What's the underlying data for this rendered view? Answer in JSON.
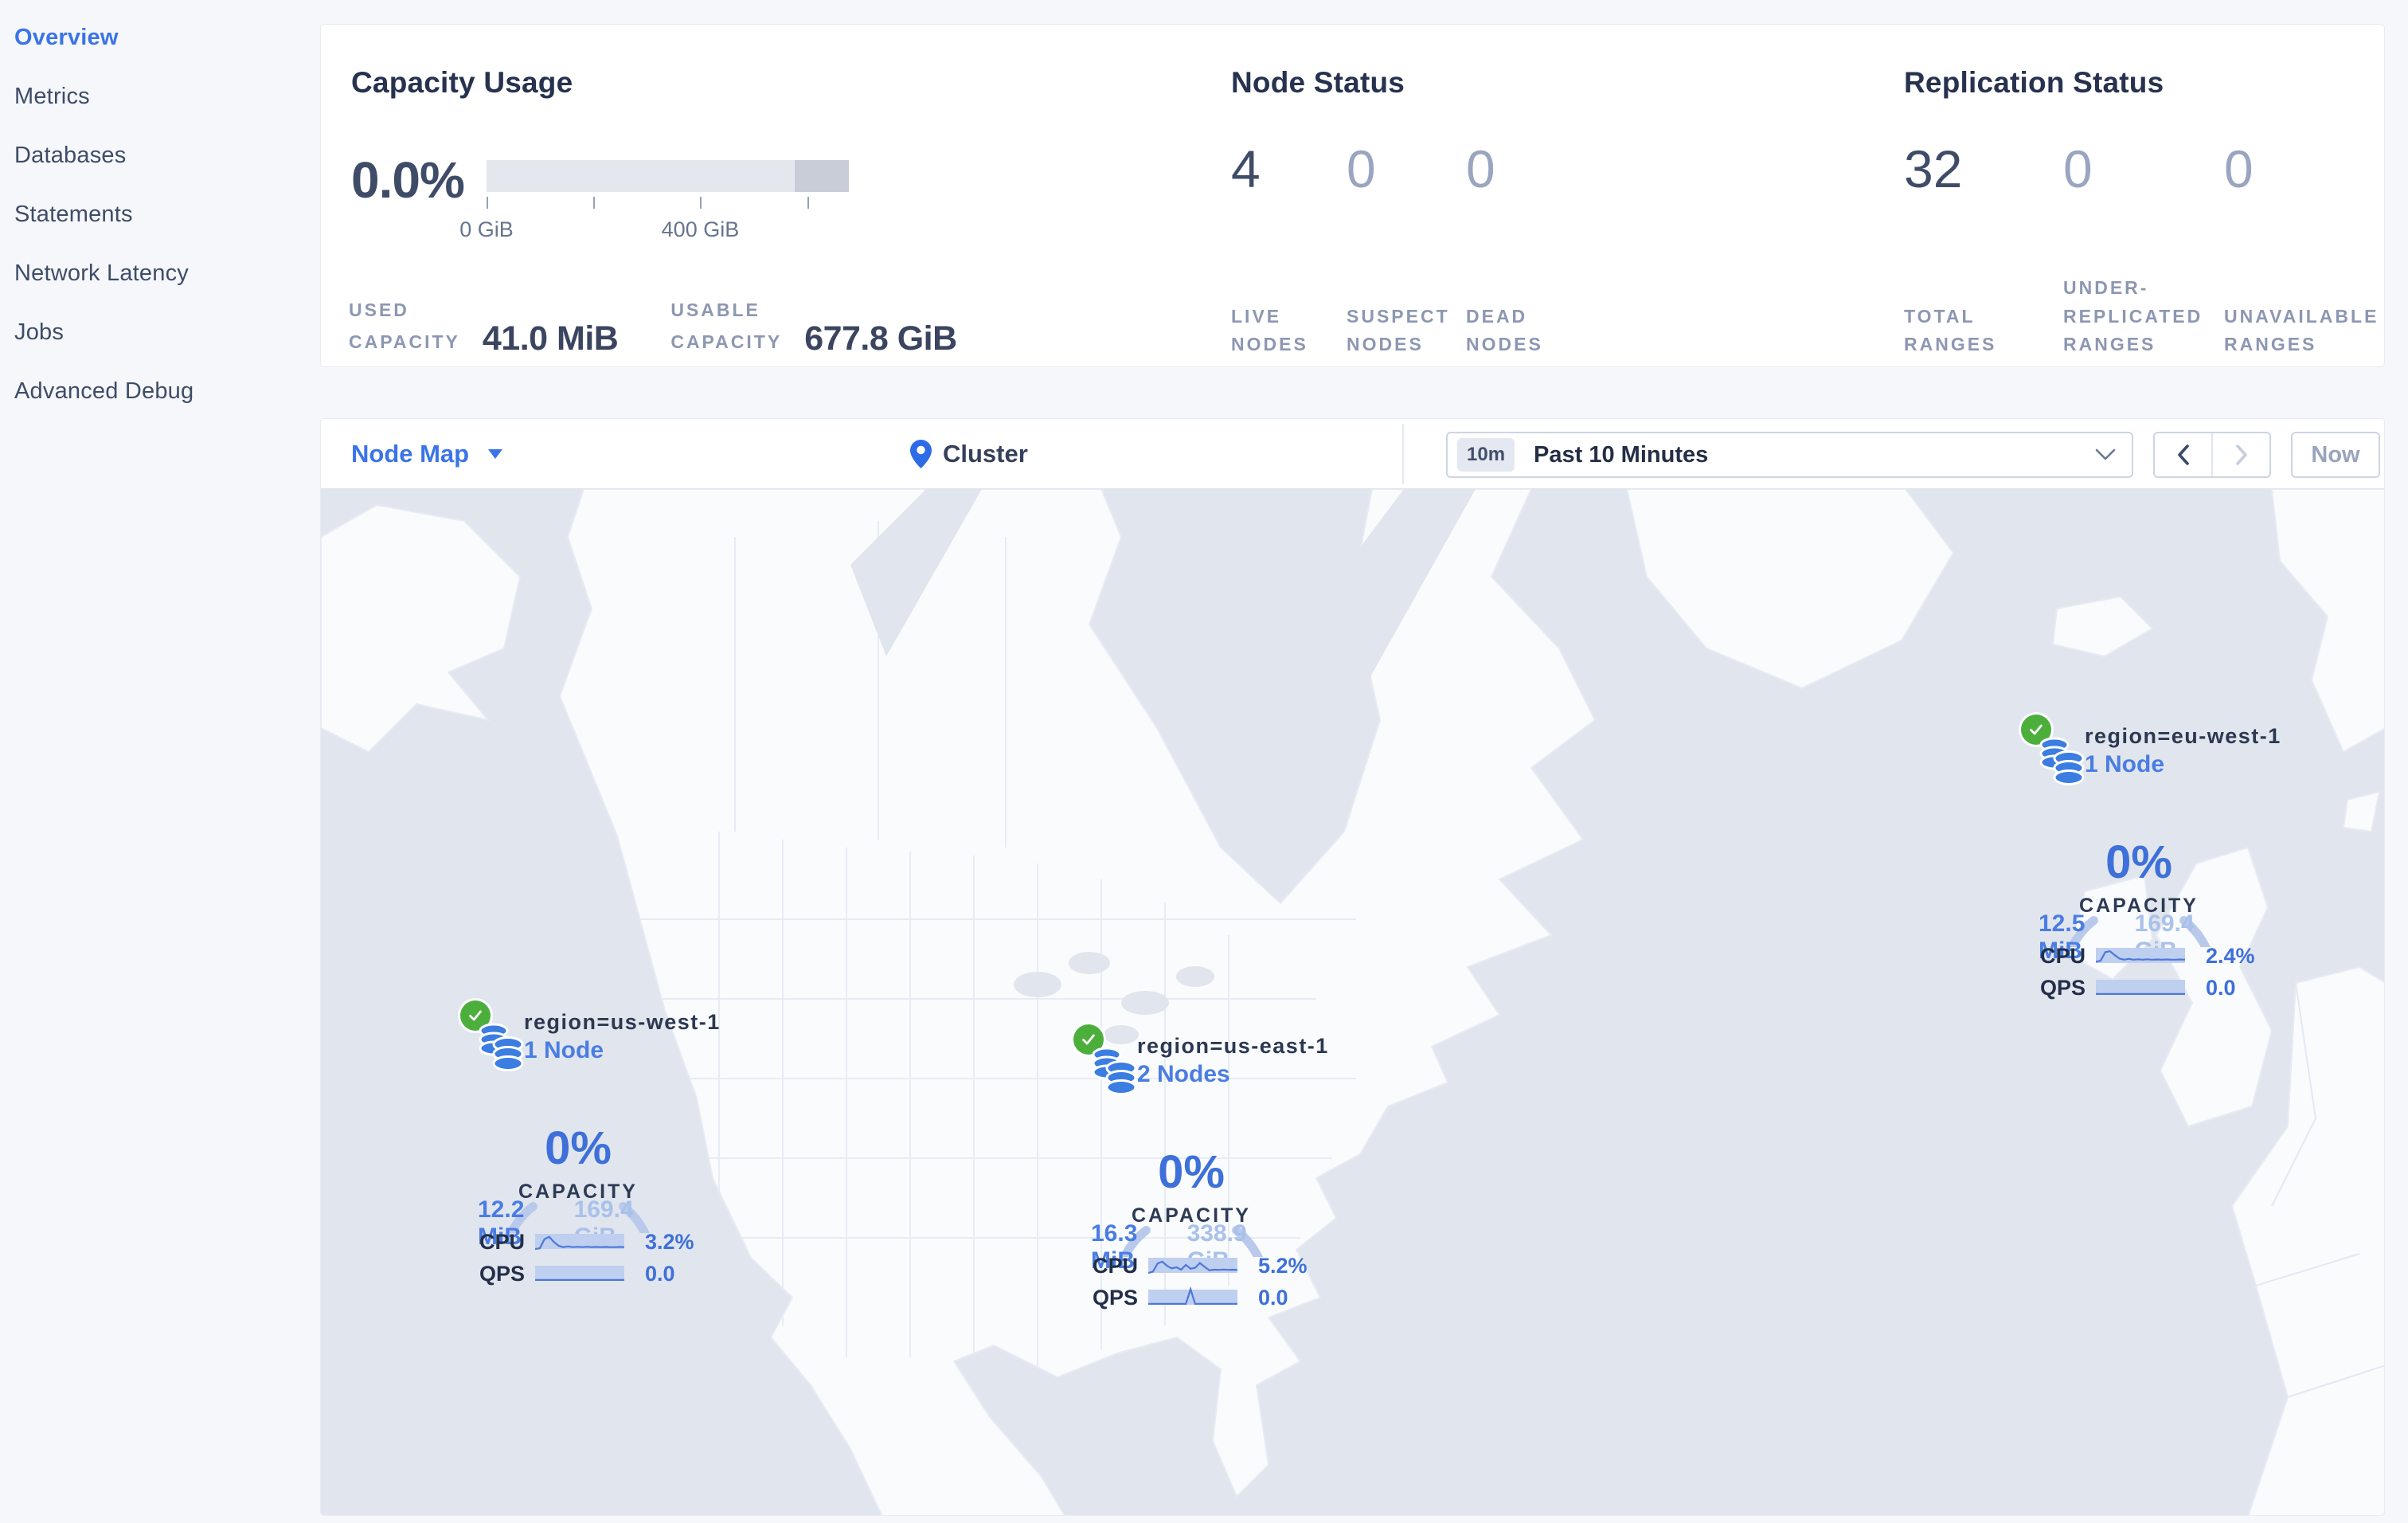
{
  "sidebar": {
    "items": [
      {
        "label": "Overview",
        "active": true
      },
      {
        "label": "Metrics",
        "active": false
      },
      {
        "label": "Databases",
        "active": false
      },
      {
        "label": "Statements",
        "active": false
      },
      {
        "label": "Network Latency",
        "active": false
      },
      {
        "label": "Jobs",
        "active": false
      },
      {
        "label": "Advanced Debug",
        "active": false
      }
    ]
  },
  "capacity_usage": {
    "title": "Capacity Usage",
    "percent": "0.0%",
    "bar": {
      "reserved_fraction": 0.15,
      "ticks": [
        {
          "pos": 0.0,
          "label": "0 GiB"
        },
        {
          "pos": 0.295,
          "label": ""
        },
        {
          "pos": 0.59,
          "label": "400 GiB"
        },
        {
          "pos": 0.885,
          "label": ""
        }
      ]
    },
    "stats": [
      {
        "label_lines": [
          "USED",
          "CAPACITY"
        ],
        "value": "41.0 MiB"
      },
      {
        "label_lines": [
          "USABLE",
          "CAPACITY"
        ],
        "value": "677.8 GiB"
      }
    ]
  },
  "node_status": {
    "title": "Node Status",
    "metrics": [
      {
        "value": "4",
        "label_lines": [
          "LIVE",
          "NODES"
        ],
        "emphasized": true
      },
      {
        "value": "0",
        "label_lines": [
          "SUSPECT",
          "NODES"
        ],
        "emphasized": false
      },
      {
        "value": "0",
        "label_lines": [
          "DEAD",
          "NODES"
        ],
        "emphasized": false
      }
    ]
  },
  "replication_status": {
    "title": "Replication Status",
    "metrics": [
      {
        "value": "32",
        "label_lines": [
          "TOTAL",
          "RANGES"
        ],
        "emphasized": true
      },
      {
        "value": "0",
        "label_lines": [
          "UNDER-",
          "REPLICATED",
          "RANGES"
        ],
        "emphasized": false
      },
      {
        "value": "0",
        "label_lines": [
          "UNAVAILABLE",
          "RANGES"
        ],
        "emphasized": false
      }
    ]
  },
  "toolbar": {
    "view_selector": "Node Map",
    "breadcrumb": "Cluster",
    "time_badge": "10m",
    "time_range": "Past 10 Minutes",
    "now_label": "Now"
  },
  "map": {
    "regions": [
      {
        "name": "region=us-west-1",
        "nodes": "1 Node",
        "capacity_percent": "0%",
        "capacity_label": "CAPACITY",
        "used": "12.2 MiB",
        "usable": "169.4 GiB",
        "cpu_label": "CPU",
        "cpu_value": "3.2%",
        "qps_label": "QPS",
        "qps_value": "0.0",
        "cpu_spark": [
          0.92,
          0.88,
          0.4,
          0.28,
          0.55,
          0.75,
          0.82,
          0.78,
          0.82,
          0.8,
          0.82,
          0.8,
          0.82,
          0.81,
          0.82,
          0.81,
          0.82,
          0.82,
          0.81,
          0.82
        ],
        "qps_spark": [
          0.87,
          0.87,
          0.87,
          0.87,
          0.87,
          0.87,
          0.87,
          0.87,
          0.87,
          0.87,
          0.87,
          0.87,
          0.87,
          0.87,
          0.87,
          0.87,
          0.87,
          0.87,
          0.87,
          0.87
        ]
      },
      {
        "name": "region=us-east-1",
        "nodes": "2 Nodes",
        "capacity_percent": "0%",
        "capacity_label": "CAPACITY",
        "used": "16.3 MiB",
        "usable": "338.9 GiB",
        "cpu_label": "CPU",
        "cpu_value": "5.2%",
        "qps_label": "QPS",
        "qps_value": "0.0",
        "cpu_spark": [
          0.92,
          0.85,
          0.42,
          0.33,
          0.55,
          0.68,
          0.62,
          0.75,
          0.5,
          0.7,
          0.65,
          0.4,
          0.6,
          0.78,
          0.75,
          0.76,
          0.74,
          0.76,
          0.75,
          0.76
        ],
        "qps_spark": [
          0.87,
          0.87,
          0.87,
          0.87,
          0.87,
          0.87,
          0.87,
          0.87,
          0.87,
          0.1,
          0.87,
          0.87,
          0.87,
          0.87,
          0.87,
          0.87,
          0.87,
          0.87,
          0.87,
          0.87
        ]
      },
      {
        "name": "region=eu-west-1",
        "nodes": "1 Node",
        "capacity_percent": "0%",
        "capacity_label": "CAPACITY",
        "used": "12.5 MiB",
        "usable": "169.4 GiB",
        "cpu_label": "CPU",
        "cpu_value": "2.4%",
        "qps_label": "QPS",
        "qps_value": "0.0",
        "cpu_spark": [
          0.85,
          0.8,
          0.35,
          0.3,
          0.5,
          0.68,
          0.74,
          0.7,
          0.74,
          0.72,
          0.74,
          0.72,
          0.74,
          0.73,
          0.74,
          0.73,
          0.74,
          0.74,
          0.73,
          0.74
        ],
        "qps_spark": [
          0.87,
          0.87,
          0.87,
          0.87,
          0.87,
          0.87,
          0.87,
          0.87,
          0.87,
          0.87,
          0.87,
          0.87,
          0.87,
          0.87,
          0.87,
          0.87,
          0.87,
          0.87,
          0.87,
          0.87
        ]
      }
    ]
  },
  "colors": {
    "accent_blue": "#3b74e8",
    "marker_blue": "#3e70d9",
    "gauge_arc": "#b9c9ec",
    "ok_green": "#4caf3c",
    "ocean": "#e1e5ed",
    "land": "#fafbfd"
  }
}
